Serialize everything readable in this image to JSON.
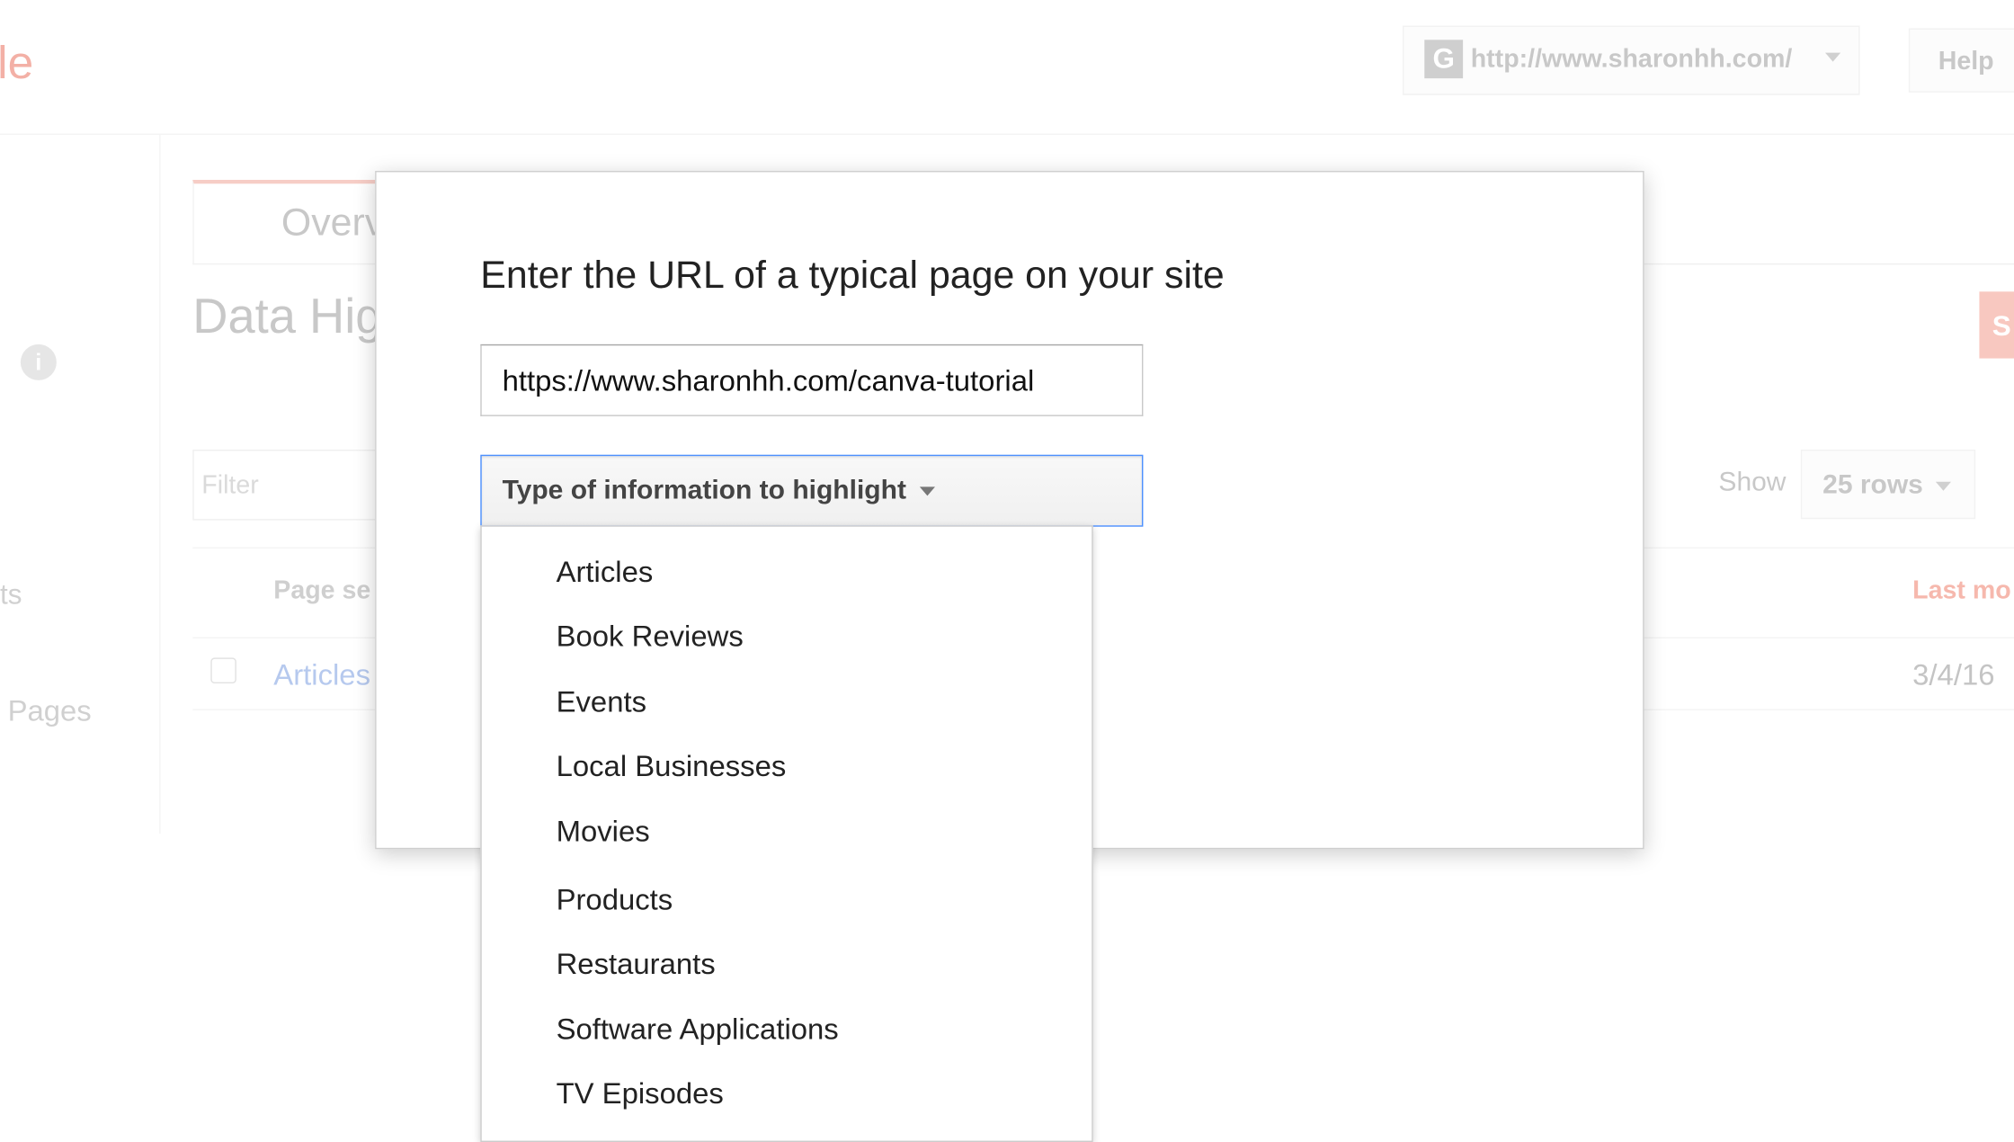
{
  "background": {
    "logo_fragment": "le",
    "account_url": "http://www.sharonhh.com/",
    "account_icon": "G",
    "help_label": "Help",
    "tab_overview": "Overv",
    "page_title": "Data Hig",
    "red_button": "S",
    "filter_placeholder": "Filter",
    "show_label": "Show",
    "rows_select": "25 rows",
    "col_page_set": "Page se",
    "col_last_modified": "Last mo",
    "row_link": "Articles",
    "row_date": "3/4/16",
    "sidebar_item_1": "ts",
    "sidebar_item_2": "Pages"
  },
  "dialog": {
    "title": "Enter the URL of a typical page on your site",
    "url_value": "https://www.sharonhh.com/canva-tutorial",
    "type_select": "Type of information to highlight",
    "options": [
      "Articles",
      "Book Reviews",
      "Events",
      "Local Businesses",
      "Movies",
      "Products",
      "Restaurants",
      "Software Applications",
      "TV Episodes"
    ]
  },
  "colors": {
    "focus_border": "#4d90fe",
    "accent": "#dd4b39"
  }
}
